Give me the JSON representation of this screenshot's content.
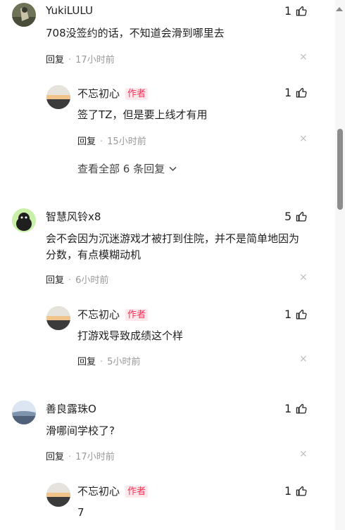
{
  "comments": [
    {
      "name": "YukiLULU",
      "likes": "1",
      "text": "708没签约的话，不知道会滑到哪里去",
      "reply_label": "回复",
      "dot": "·",
      "time": "17小时前",
      "close": "×",
      "avatar_icon": "avatar-photo-icon",
      "reply": {
        "name": "不忘初心",
        "author_tag": "作者",
        "likes": "1",
        "text": "签了TZ，但是要上线才有用",
        "reply_label": "回复",
        "dot": "·",
        "time": "15小时前",
        "close": "×"
      },
      "expand": "查看全部 6 条回复"
    },
    {
      "name": "智慧风铃x8",
      "likes": "5",
      "text": "会不会因为沉迷游戏才被打到住院，并不是简单地因为分数，有点模糊动机",
      "reply_label": "回复",
      "dot": "·",
      "time": "6小时前",
      "close": "×",
      "reply": {
        "name": "不忘初心",
        "author_tag": "作者",
        "likes": "1",
        "text": "打游戏导致成绩这个样",
        "reply_label": "回复",
        "dot": "·",
        "time": "5小时前",
        "close": "×"
      }
    },
    {
      "name": "善良露珠O",
      "likes": "1",
      "text": "滑哪间学校了?",
      "reply_label": "回复",
      "dot": "·",
      "time": "17小时前",
      "close": "×",
      "reply": {
        "name": "不忘初心",
        "author_tag": "作者",
        "likes": "1",
        "text": "7"
      }
    }
  ],
  "colors": {
    "author_tag": "#fe2c55",
    "meta": "#999999"
  }
}
